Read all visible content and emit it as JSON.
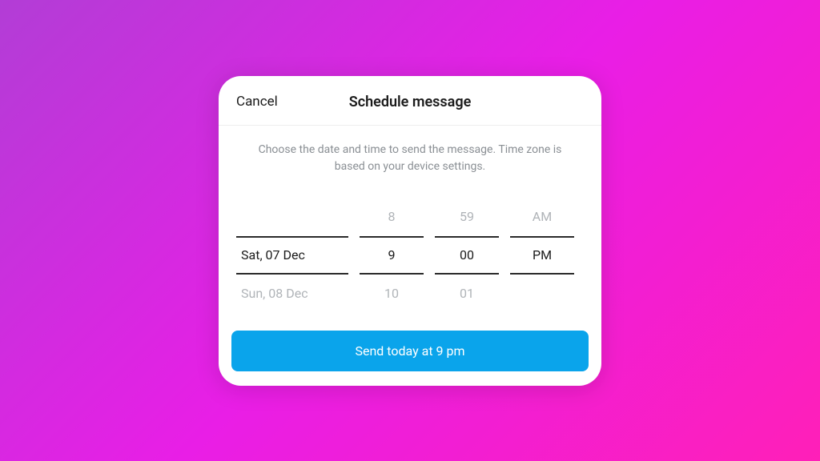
{
  "header": {
    "cancel_label": "Cancel",
    "title": "Schedule message"
  },
  "body": {
    "description": "Choose the date and time to send the message. Time zone is based on your device settings."
  },
  "picker": {
    "date": {
      "prev": "",
      "current": "Sat, 07 Dec",
      "next": "Sun, 08 Dec"
    },
    "hour": {
      "prev": "8",
      "current": "9",
      "next": "10"
    },
    "minute": {
      "prev": "59",
      "current": "00",
      "next": "01"
    },
    "ampm": {
      "prev": "AM",
      "current": "PM",
      "next": ""
    }
  },
  "footer": {
    "send_label": "Send today at 9 pm"
  }
}
